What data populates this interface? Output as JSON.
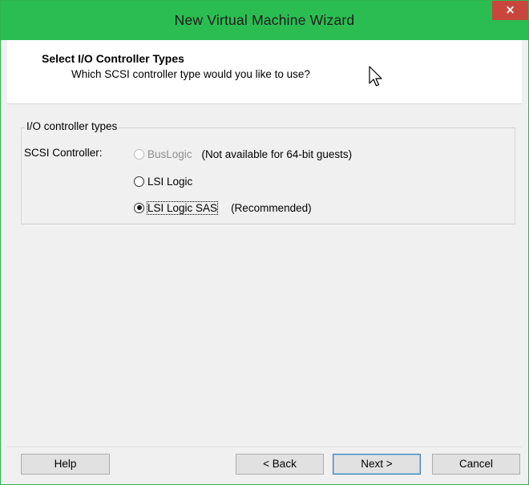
{
  "window": {
    "title": "New Virtual Machine Wizard",
    "close_glyph": "×",
    "accent_color": "#2bbd52"
  },
  "header": {
    "title": "Select I/O Controller Types",
    "subtitle": "Which SCSI controller type would you like to use?"
  },
  "group": {
    "legend": "I/O controller types",
    "scsi_label": "SCSI Controller:",
    "options": [
      {
        "label": "BusLogic",
        "note": "(Not available for 64-bit guests)",
        "state": "disabled"
      },
      {
        "label": "LSI Logic",
        "note": "",
        "state": "unchecked"
      },
      {
        "label": "LSI Logic SAS",
        "note": "(Recommended)",
        "state": "checked"
      }
    ]
  },
  "buttons": {
    "help": "Help",
    "back": "< Back",
    "next": "Next >",
    "cancel": "Cancel"
  },
  "icons": {
    "close": "close-icon",
    "cursor": "mouse-pointer-icon"
  }
}
